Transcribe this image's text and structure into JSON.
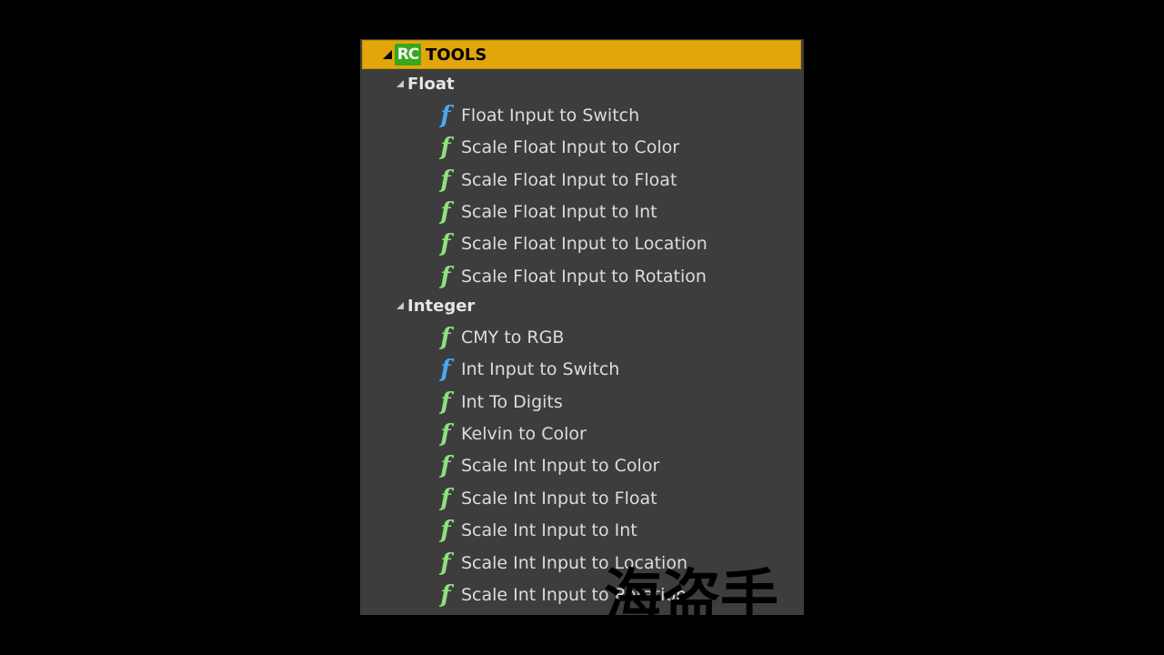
{
  "header": {
    "badge": "RC",
    "title": "TOOLS"
  },
  "categories": [
    {
      "label": "Float",
      "items": [
        {
          "label": "Float Input to Switch",
          "icon": "function-icon-blue"
        },
        {
          "label": "Scale Float Input to Color",
          "icon": "function-icon-green"
        },
        {
          "label": "Scale Float Input to Float",
          "icon": "function-icon-green"
        },
        {
          "label": "Scale Float Input to Int",
          "icon": "function-icon-green"
        },
        {
          "label": "Scale Float Input to Location",
          "icon": "function-icon-green"
        },
        {
          "label": "Scale Float Input to Rotation",
          "icon": "function-icon-green"
        }
      ]
    },
    {
      "label": "Integer",
      "items": [
        {
          "label": "CMY to RGB",
          "icon": "function-icon-green"
        },
        {
          "label": "Int Input to Switch",
          "icon": "function-icon-blue"
        },
        {
          "label": "Int To Digits",
          "icon": "function-icon-green"
        },
        {
          "label": "Kelvin to Color",
          "icon": "function-icon-green"
        },
        {
          "label": "Scale Int Input to Color",
          "icon": "function-icon-green"
        },
        {
          "label": "Scale Int Input to Float",
          "icon": "function-icon-green"
        },
        {
          "label": "Scale Int Input to Int",
          "icon": "function-icon-green"
        },
        {
          "label": "Scale Int Input to Location",
          "icon": "function-icon-green"
        },
        {
          "label": "Scale Int Input to Rotation",
          "icon": "function-icon-green"
        }
      ]
    }
  ],
  "icon_glyph": "f",
  "watermark": "海盗手",
  "colors": {
    "header_bg": "#e2a60c",
    "badge_bg": "#35a81c",
    "panel_bg": "#3d3d3d",
    "function_blue": "#4aa8f0",
    "function_green": "#8fe07f"
  }
}
